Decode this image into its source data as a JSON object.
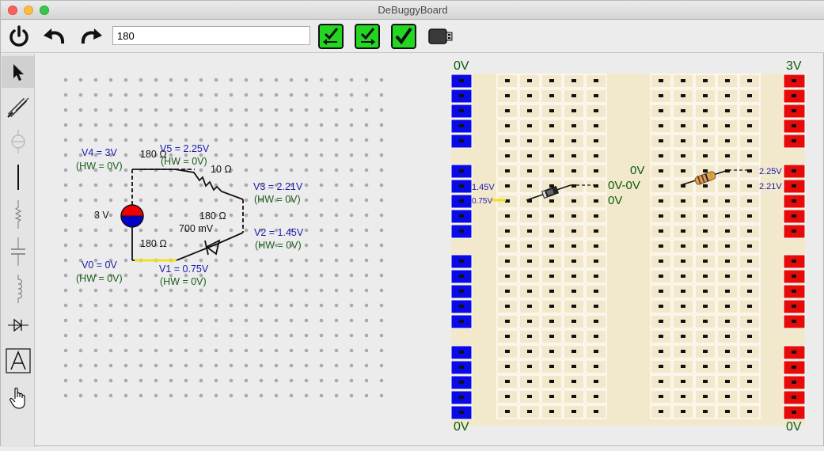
{
  "window": {
    "title": "DeBuggyBoard"
  },
  "toolbar": {
    "value_field": "180",
    "icons": [
      "power-icon",
      "undo-icon",
      "redo-icon",
      "check-left-arrow-icon",
      "check-right-arrow-icon",
      "check-icon",
      "usb-icon"
    ]
  },
  "palette": {
    "tools": [
      "pointer-icon",
      "wire-pencil-icon",
      "source-icon",
      "wire-icon",
      "resistor-icon",
      "capacitor-icon",
      "inductor-icon",
      "diode-icon",
      "text-icon",
      "hand-icon"
    ]
  },
  "schematic": {
    "labels": {
      "v4": "V4 = 3V",
      "v4_hw": "(HW = 0V)",
      "v5": "V5 = 2.25V",
      "v5_hw": "(HW = 0V)",
      "v3": "V3 = 2.21V",
      "v3_hw": "(HW = 0V)",
      "v2": "V2 = 1.45V",
      "v2_hw": "(HW = 0V)",
      "v1": "V1 = 0.75V",
      "v1_hw": "(HW = 0V)",
      "v0": "V0 = 0V",
      "v0_hw": "(HW = 0V)",
      "r_top": "180 Ω",
      "r_10": "10 Ω",
      "r_right": "180 Ω",
      "diode": "700 mV",
      "r_bottom": "180 Ω",
      "source": "3 V"
    }
  },
  "breadboard": {
    "rail_left_top": "0V",
    "rail_right_top": "3V",
    "rail_left_bottom": "0V",
    "rail_right_bottom": "0V",
    "labels": {
      "v145": "1.45V",
      "v075": "0.75V",
      "v0a": "0V",
      "v0b": "0V-0V",
      "v0c": "0V",
      "v225": "2.25V",
      "v221": "2.21V"
    }
  },
  "colors": {
    "rail_negative": "#0a0ae6",
    "rail_positive": "#e60a0a",
    "board": "#f2e8cc",
    "voltage_label": "#1a1aaa",
    "hw_label": "#1a5c1a",
    "button_green": "#22d622"
  }
}
